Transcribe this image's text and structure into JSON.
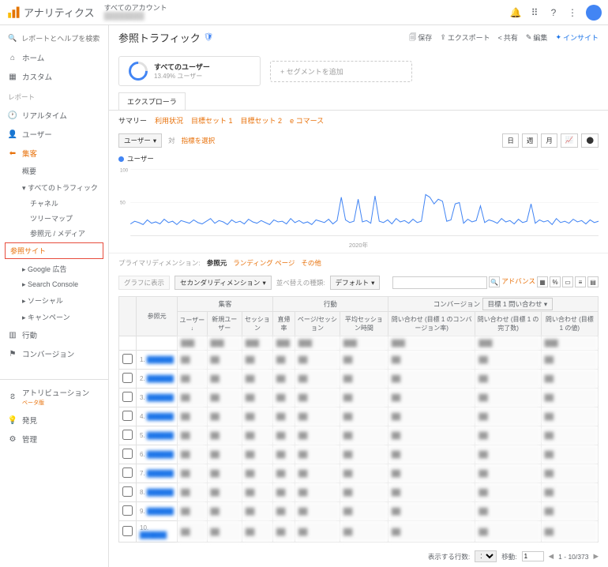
{
  "header": {
    "product": "アナリティクス",
    "account_label": "すべてのアカウント"
  },
  "sidebar": {
    "search_placeholder": "レポートとヘルプを検索",
    "home": "ホーム",
    "custom": "カスタム",
    "reports_section": "レポート",
    "realtime": "リアルタイム",
    "user": "ユーザー",
    "acquisition": "集客",
    "overview": "概要",
    "all_traffic": "すべてのトラフィック",
    "channels": "チャネル",
    "treemap": "ツリーマップ",
    "source_medium": "参照元 / メディア",
    "referral": "参照サイト",
    "google_ads": "Google 広告",
    "search_console": "Search Console",
    "social": "ソーシャル",
    "campaigns": "キャンペーン",
    "behavior": "行動",
    "conversion": "コンバージョン",
    "attribution": "アトリビューション",
    "attribution_badge": "ベータ版",
    "discover": "発見",
    "admin": "管理"
  },
  "page": {
    "title": "参照トラフィック",
    "toolbar": {
      "save": "保存",
      "export": "エクスポート",
      "share": "共有",
      "edit": "編集",
      "insights": "インサイト"
    }
  },
  "segments": {
    "all_users": "すべてのユーザー",
    "all_users_pct": "13.49% ユーザー",
    "add_segment": "+ セグメントを追加"
  },
  "tabs": {
    "explorer": "エクスプローラ",
    "summary": "サマリー",
    "usage": "利用状況",
    "goalset1": "目標セット 1",
    "goalset2": "目標セット 2",
    "ecommerce": "e コマース"
  },
  "chart_ctrl": {
    "metric_dd": "ユーザー",
    "vs": "対",
    "compare": "指標を選択",
    "day": "日",
    "week": "週",
    "month": "月"
  },
  "chart": {
    "legend": "ユーザー",
    "xlabel": "2020年"
  },
  "chart_data": {
    "type": "line",
    "ylabel": "ユーザー",
    "ylim": [
      0,
      100
    ],
    "yticks": [
      50,
      100
    ],
    "x_range_label": "2020年",
    "series": [
      {
        "name": "ユーザー",
        "color": "#4285f4",
        "values": [
          18,
          22,
          20,
          17,
          24,
          19,
          21,
          18,
          25,
          20,
          22,
          17,
          23,
          21,
          19,
          24,
          20,
          18,
          22,
          26,
          19,
          23,
          21,
          17,
          24,
          20,
          22,
          18,
          25,
          21,
          19,
          23,
          20,
          17,
          24,
          21,
          22,
          18,
          26,
          20,
          23,
          19,
          21,
          17,
          24,
          22,
          20,
          25,
          18,
          23,
          58,
          24,
          20,
          22,
          55,
          21,
          23,
          19,
          60,
          22,
          20,
          24,
          18,
          26,
          21,
          23,
          19,
          25,
          20,
          22,
          62,
          58,
          48,
          55,
          52,
          22,
          24,
          48,
          50,
          19,
          25,
          21,
          23,
          45,
          20,
          24,
          22,
          19,
          26,
          21,
          23,
          18,
          25,
          20,
          22,
          48,
          19,
          24,
          21,
          23,
          17,
          26,
          20,
          22,
          19,
          25,
          21,
          23,
          18,
          24,
          20,
          22
        ]
      }
    ]
  },
  "dim": {
    "label": "プライマリディメンション:",
    "active": "参照元",
    "landing": "ランディング ページ",
    "other": "その他"
  },
  "filter": {
    "plot_rows": "グラフに表示",
    "secondary_dim": "セカンダリディメンション",
    "sort_type": "並べ替えの種類:",
    "default": "デフォルト",
    "advanced": "アドバンス"
  },
  "table": {
    "col_referrer": "参照元",
    "grp_acquisition": "集客",
    "grp_behavior": "行動",
    "grp_conversion": "コンバージョン",
    "conv_dd": "目標 1 問い合わせ",
    "col_users": "ユーザー",
    "col_new_users": "新規ユーザー",
    "col_sessions": "セッション",
    "col_bounce": "直帰率",
    "col_pages_session": "ページ/セッション",
    "col_avg_duration": "平均セッション時間",
    "col_goal_cr": "問い合わせ (目標 1 のコンバージョン率)",
    "col_goal_comp": "問い合わせ (目標 1 の完了数)",
    "col_goal_val": "問い合わせ (目標 1 の値)"
  },
  "pagination": {
    "rows_label": "表示する行数:",
    "rows_value": "10",
    "goto_label": "移動:",
    "goto_value": "1",
    "range": "1 - 10/373"
  }
}
